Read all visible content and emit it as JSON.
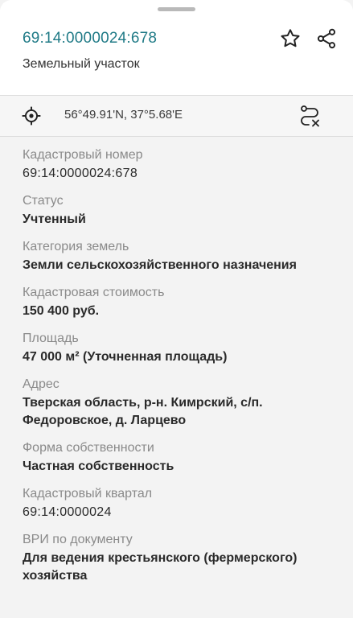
{
  "header": {
    "cadastral_number": "69:14:0000024:678",
    "object_type": "Земельный участок"
  },
  "coords": {
    "text": "56°49.91'N, 37°5.68'E"
  },
  "fields": [
    {
      "label": "Кадастровый номер",
      "value": "69:14:0000024:678"
    },
    {
      "label": "Статус",
      "value": "Учтенный"
    },
    {
      "label": "Категория земель",
      "value": "Земли сельскохозяйственного назначения"
    },
    {
      "label": "Кадастровая стоимость",
      "value": "150 400 руб."
    },
    {
      "label": "Площадь",
      "value": "47 000 м² (Уточненная площадь)"
    },
    {
      "label": "Адрес",
      "value": "Тверская область, р-н. Кимрский, с/п. Федоровское, д. Ларцево"
    },
    {
      "label": "Форма собственности",
      "value": "Частная собственность"
    },
    {
      "label": "Кадастровый квартал",
      "value": "69:14:0000024"
    },
    {
      "label": "ВРИ по документу",
      "value": "Для ведения крестьянского (фермерского) хозяйства"
    }
  ],
  "colors": {
    "accent": "#1f7a86",
    "label": "#8a8a8a",
    "value": "#2a2a2a"
  }
}
